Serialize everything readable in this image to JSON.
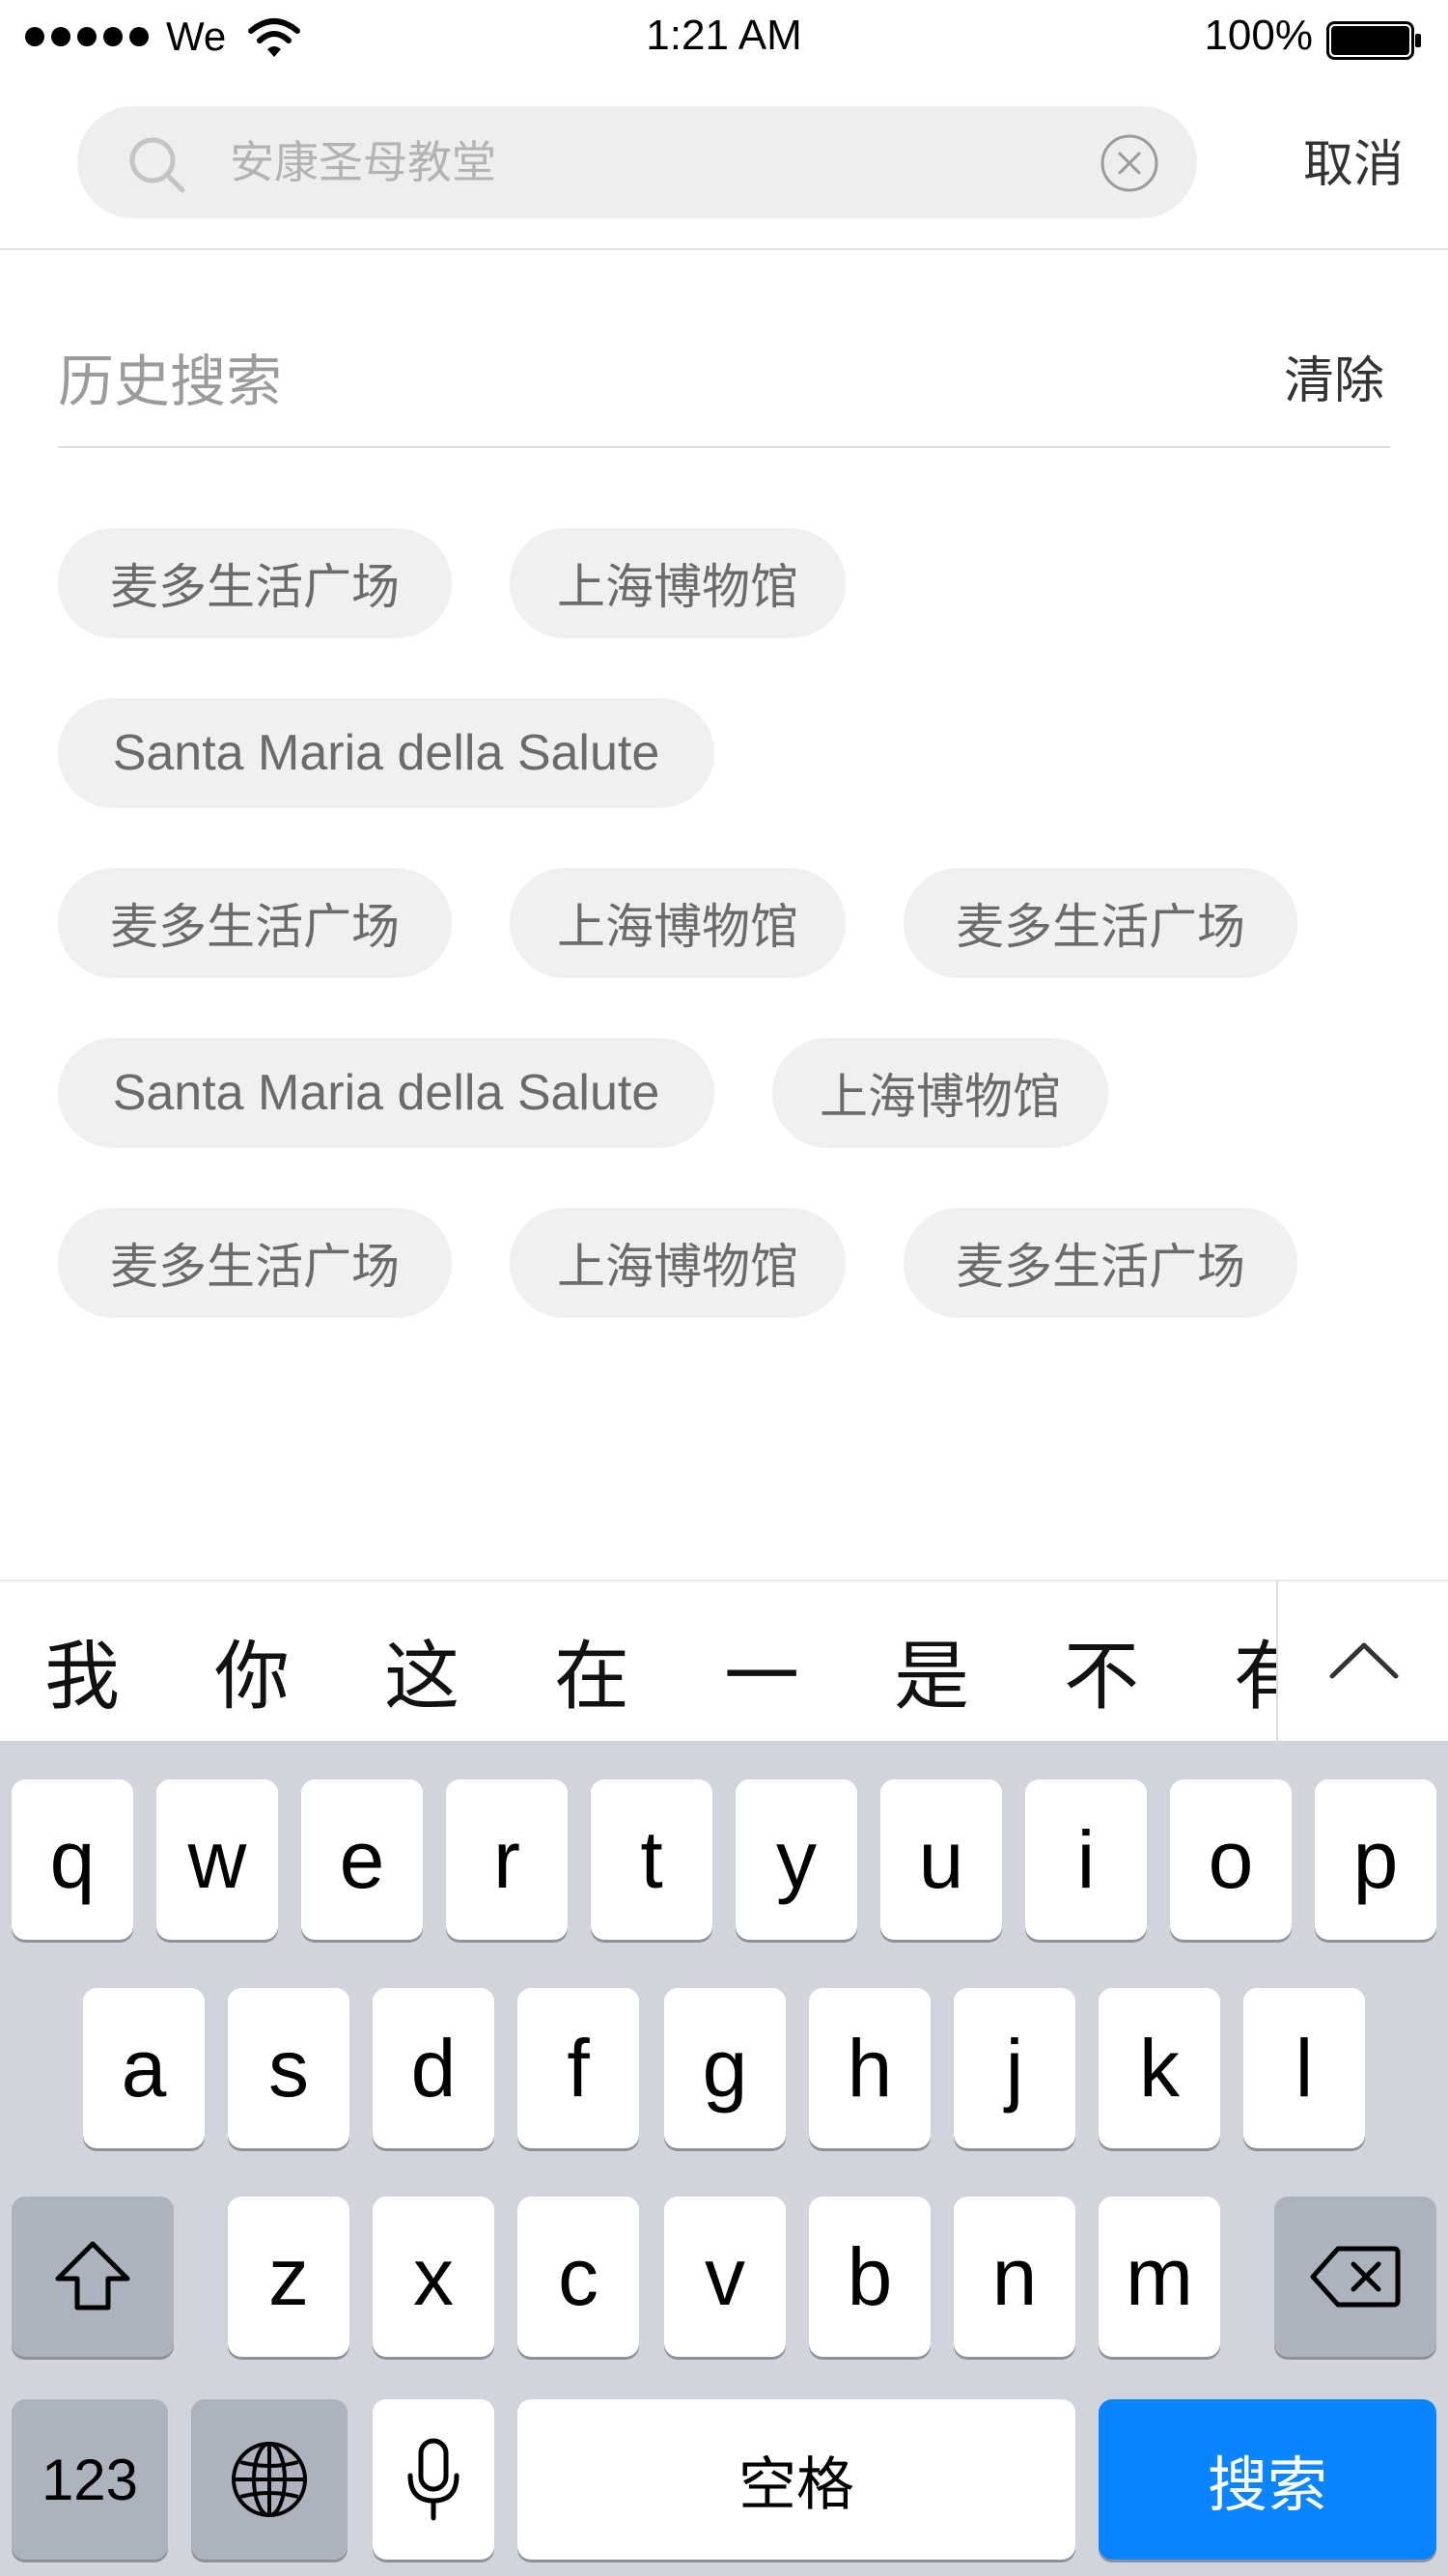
{
  "status_bar": {
    "carrier": "We",
    "time": "1:21 AM",
    "battery_percent": "100%",
    "battery_level": 1.0
  },
  "search": {
    "placeholder": "安康圣母教堂",
    "cancel_label": "取消"
  },
  "history": {
    "title": "历史搜索",
    "clear_label": "清除",
    "items": [
      "麦多生活广场",
      "上海博物馆",
      "Santa Maria della Salute",
      "麦多生活广场",
      "上海博物馆",
      "麦多生活广场",
      "Santa Maria della Salute",
      "上海博物馆",
      "麦多生活广场",
      "上海博物馆",
      "麦多生活广场"
    ]
  },
  "suggestions": {
    "words": [
      "我",
      "你",
      "这",
      "在",
      "一",
      "是",
      "不",
      "有"
    ],
    "expand_icon": "chevron-up-icon"
  },
  "keyboard": {
    "row1": [
      "q",
      "w",
      "e",
      "r",
      "t",
      "y",
      "u",
      "i",
      "o",
      "p"
    ],
    "row2": [
      "a",
      "s",
      "d",
      "f",
      "g",
      "h",
      "j",
      "k",
      "l"
    ],
    "row3": [
      "z",
      "x",
      "c",
      "v",
      "b",
      "n",
      "m"
    ],
    "shift_icon": "shift-icon",
    "delete_icon": "backspace-icon",
    "numbers_label": "123",
    "globe_icon": "globe-icon",
    "mic_icon": "microphone-icon",
    "space_label": "空格",
    "search_label": "搜索"
  },
  "colors": {
    "accent": "#0a84ff",
    "chip_background": "#f0f0f0",
    "keyboard_background": "#d1d5db"
  }
}
